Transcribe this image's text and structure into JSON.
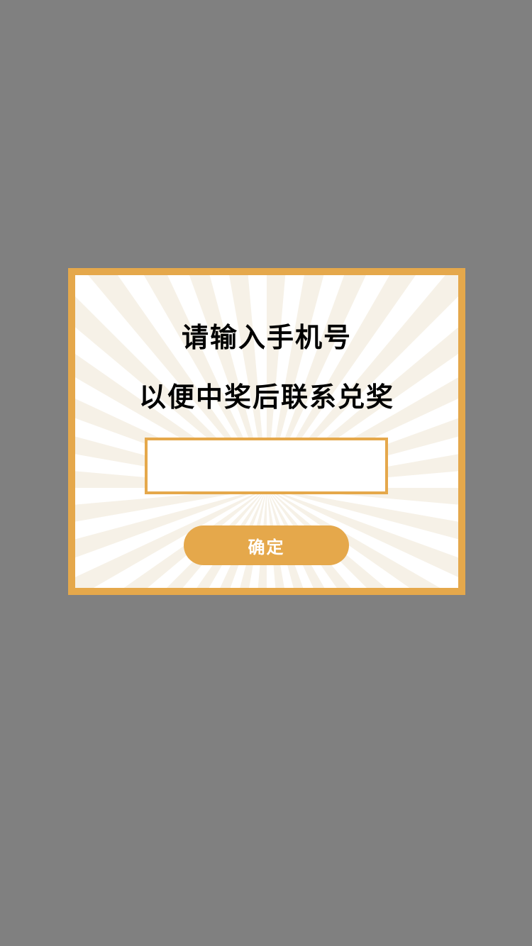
{
  "overlay": {
    "background_color": "#808080"
  },
  "dialog": {
    "border_color": "#E5A84B",
    "title_line_1": "请输入手机号",
    "title_line_2": "以便中奖后联系兑奖",
    "phone_input": {
      "value": "",
      "placeholder": ""
    },
    "confirm_label": "确定",
    "accent_color": "#E5A84B"
  }
}
